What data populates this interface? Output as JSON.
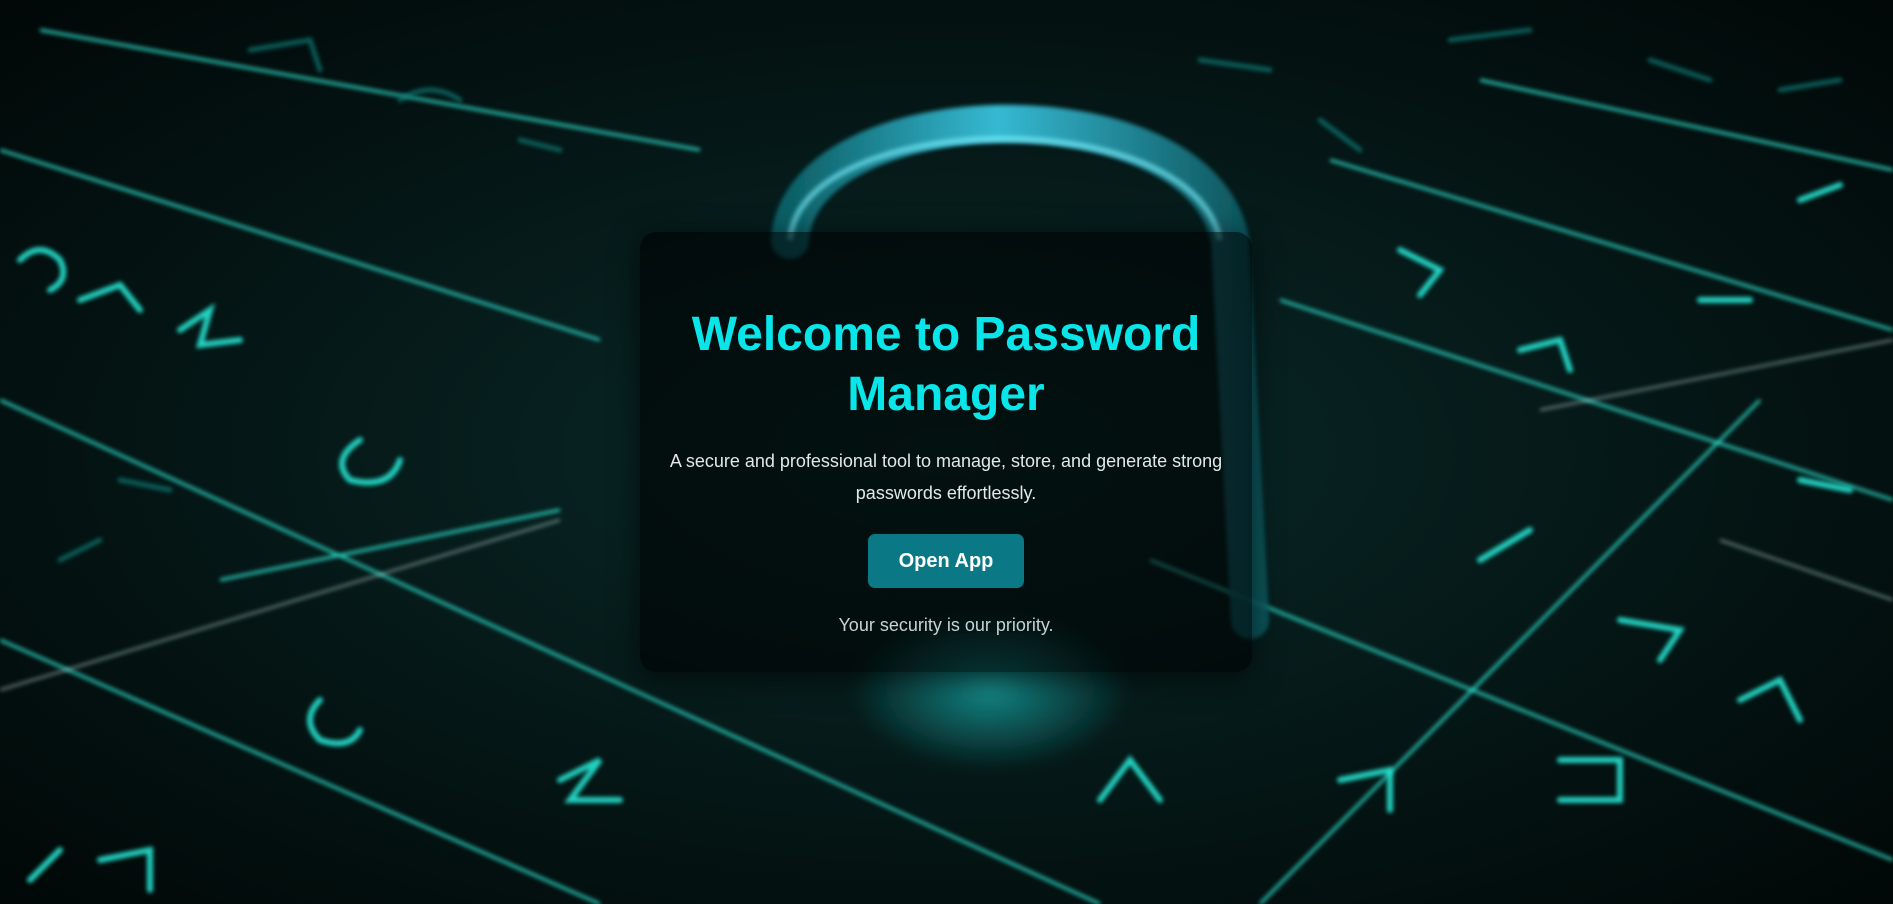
{
  "hero": {
    "title": "Welcome to Password Manager",
    "subtitle": "A secure and professional tool to manage, store, and generate strong passwords effortlessly.",
    "button_label": "Open App",
    "footer_note": "Your security is our priority."
  },
  "background": {
    "description_icon": "padlock-circuit-keyboard-image"
  },
  "colors": {
    "accent": "#08e6ea",
    "button": "#0b7886",
    "card_bg": "rgba(0,0,0,0.58)",
    "glow": "#13d8d0"
  }
}
